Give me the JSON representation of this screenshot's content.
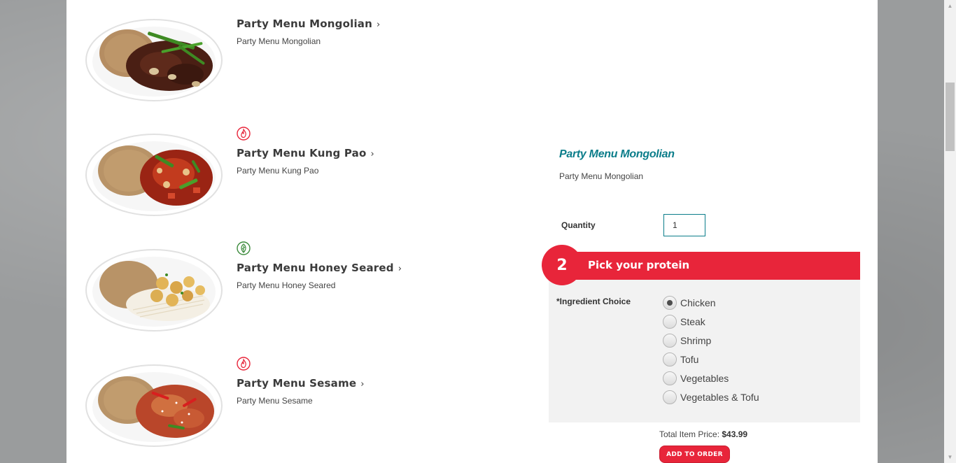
{
  "menu_items": [
    {
      "title": "Party Menu Mongolian",
      "desc": "Party Menu Mongolian",
      "badge": null
    },
    {
      "title": "Party Menu Kung Pao",
      "desc": "Party Menu Kung Pao",
      "badge": "spicy-icon"
    },
    {
      "title": "Party Menu Honey Seared",
      "desc": "Party Menu Honey Seared",
      "badge": "wok-smart-icon"
    },
    {
      "title": "Party Menu Sesame",
      "desc": "Party Menu Sesame",
      "badge": "spicy-icon"
    }
  ],
  "chevron": "›",
  "detail": {
    "title": "Party Menu Mongolian",
    "desc": "Party Menu Mongolian",
    "quantity_label": "Quantity",
    "quantity_value": "1"
  },
  "protein": {
    "step": "2",
    "title": "Pick your protein",
    "ingredient_label": "*Ingredient Choice",
    "options": [
      "Chicken",
      "Steak",
      "Shrimp",
      "Tofu",
      "Vegetables",
      "Vegetables & Tofu"
    ],
    "selected": "Chicken"
  },
  "order": {
    "total_label": "Total Item Price:",
    "total_value": "$43.99",
    "add_button": "ADD TO ORDER"
  },
  "colors": {
    "brand_red": "#e8253a",
    "accent_teal": "#0b7d8a"
  }
}
